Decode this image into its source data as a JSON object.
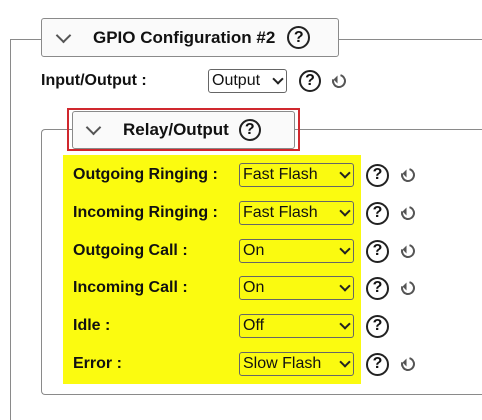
{
  "gpio": {
    "title": "GPIO Configuration #2",
    "help": "?",
    "io": {
      "label": "Input/Output :",
      "value": "Output",
      "help": "?"
    }
  },
  "relay": {
    "title": "Relay/Output",
    "help": "?",
    "rows": [
      {
        "label": "Outgoing Ringing :",
        "value": "Fast Flash",
        "help": "?",
        "has_reset": true
      },
      {
        "label": "Incoming Ringing :",
        "value": "Fast Flash",
        "help": "?",
        "has_reset": true
      },
      {
        "label": "Outgoing Call :",
        "value": "On",
        "help": "?",
        "has_reset": true
      },
      {
        "label": "Incoming Call :",
        "value": "On",
        "help": "?",
        "has_reset": true
      },
      {
        "label": "Idle :",
        "value": "Off",
        "help": "?",
        "has_reset": false
      },
      {
        "label": "Error :",
        "value": "Slow Flash",
        "help": "?",
        "has_reset": true
      }
    ]
  },
  "colors": {
    "highlight": "#fbfb10",
    "annotation_border": "#d0282e"
  },
  "icons": {
    "collapse": "chevron-down-icon",
    "help": "help-circle-icon",
    "reset": "reset-icon"
  }
}
